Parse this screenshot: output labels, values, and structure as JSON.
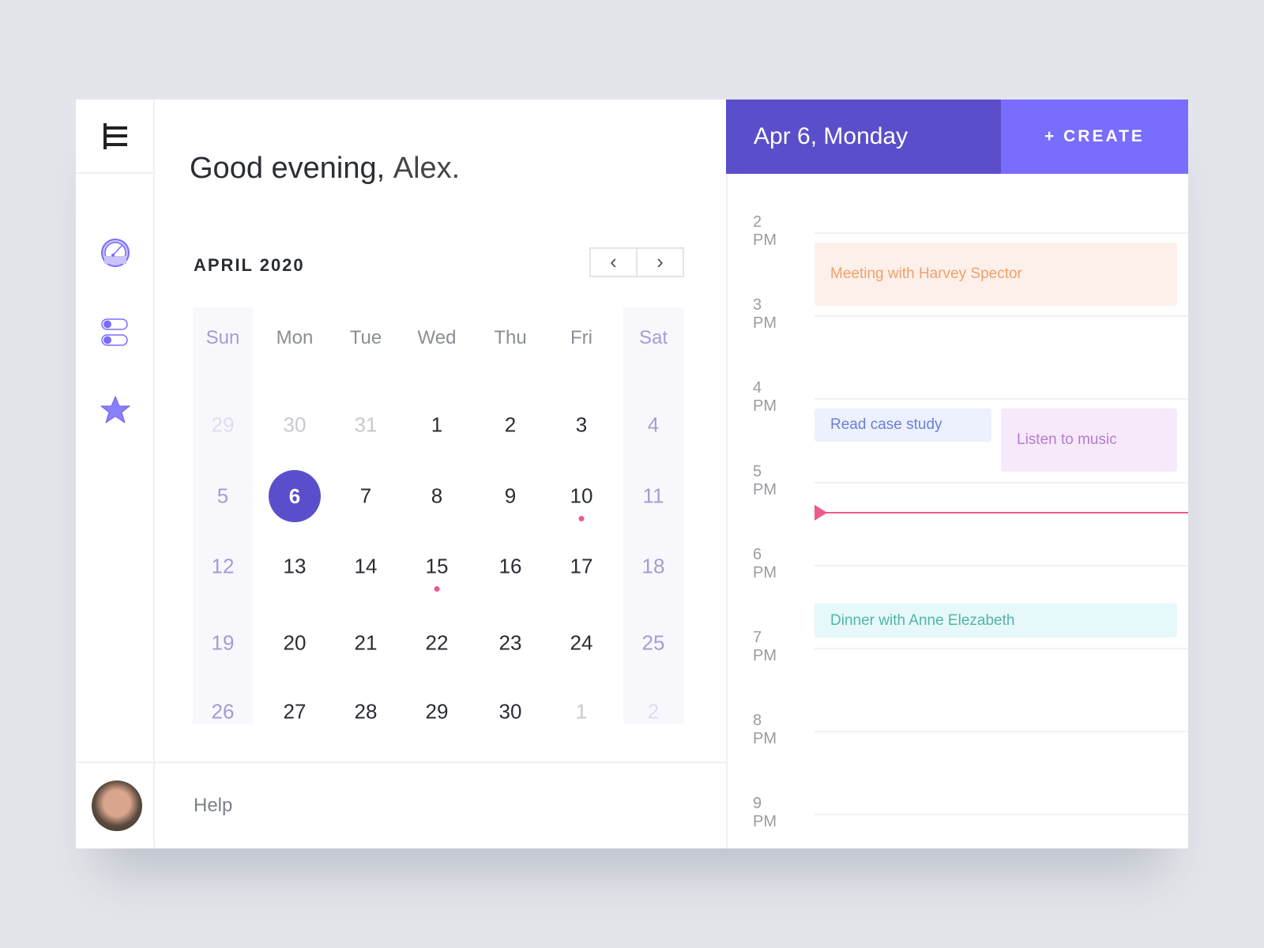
{
  "greeting": {
    "prefix": "Good evening,",
    "name": "Alex."
  },
  "calendar": {
    "month_label": "APRIL 2020",
    "prev": "‹",
    "next": "›",
    "weekdays": [
      "Sun",
      "Mon",
      "Tue",
      "Wed",
      "Thu",
      "Fri",
      "Sat"
    ],
    "weeks": [
      [
        "29",
        "30",
        "31",
        "1",
        "2",
        "3",
        "4"
      ],
      [
        "5",
        "6",
        "7",
        "8",
        "9",
        "10",
        "11"
      ],
      [
        "12",
        "13",
        "14",
        "15",
        "16",
        "17",
        "18"
      ],
      [
        "19",
        "20",
        "21",
        "22",
        "23",
        "24",
        "25"
      ],
      [
        "26",
        "27",
        "28",
        "29",
        "30",
        "1",
        "2"
      ]
    ],
    "selected_day": "6",
    "event_dot_days": [
      "10",
      "15"
    ]
  },
  "sidebar": {
    "icons": [
      "menu-icon",
      "dashboard-gauge-icon",
      "toggles-icon",
      "star-icon"
    ]
  },
  "footer": {
    "help": "Help"
  },
  "schedule": {
    "date_prefix": "Apr 6,",
    "date_day": "Monday",
    "create_label": "+ CREATE",
    "hours": [
      "2 PM",
      "3 PM",
      "4 PM",
      "5 PM",
      "6 PM",
      "7 PM",
      "8 PM",
      "9 PM"
    ],
    "events": [
      {
        "title": "Meeting with Harvey Spector",
        "color": "#f0a06b"
      },
      {
        "title": "Read case study",
        "color": "#6a7fd6"
      },
      {
        "title": "Listen to music",
        "color": "#b57cd0"
      },
      {
        "title": "Dinner with Anne Elezabeth",
        "color": "#52b5a8"
      }
    ]
  },
  "colors": {
    "accent": "#5b4ecb",
    "create": "#786dfd",
    "now_line": "#ec5a8a"
  }
}
